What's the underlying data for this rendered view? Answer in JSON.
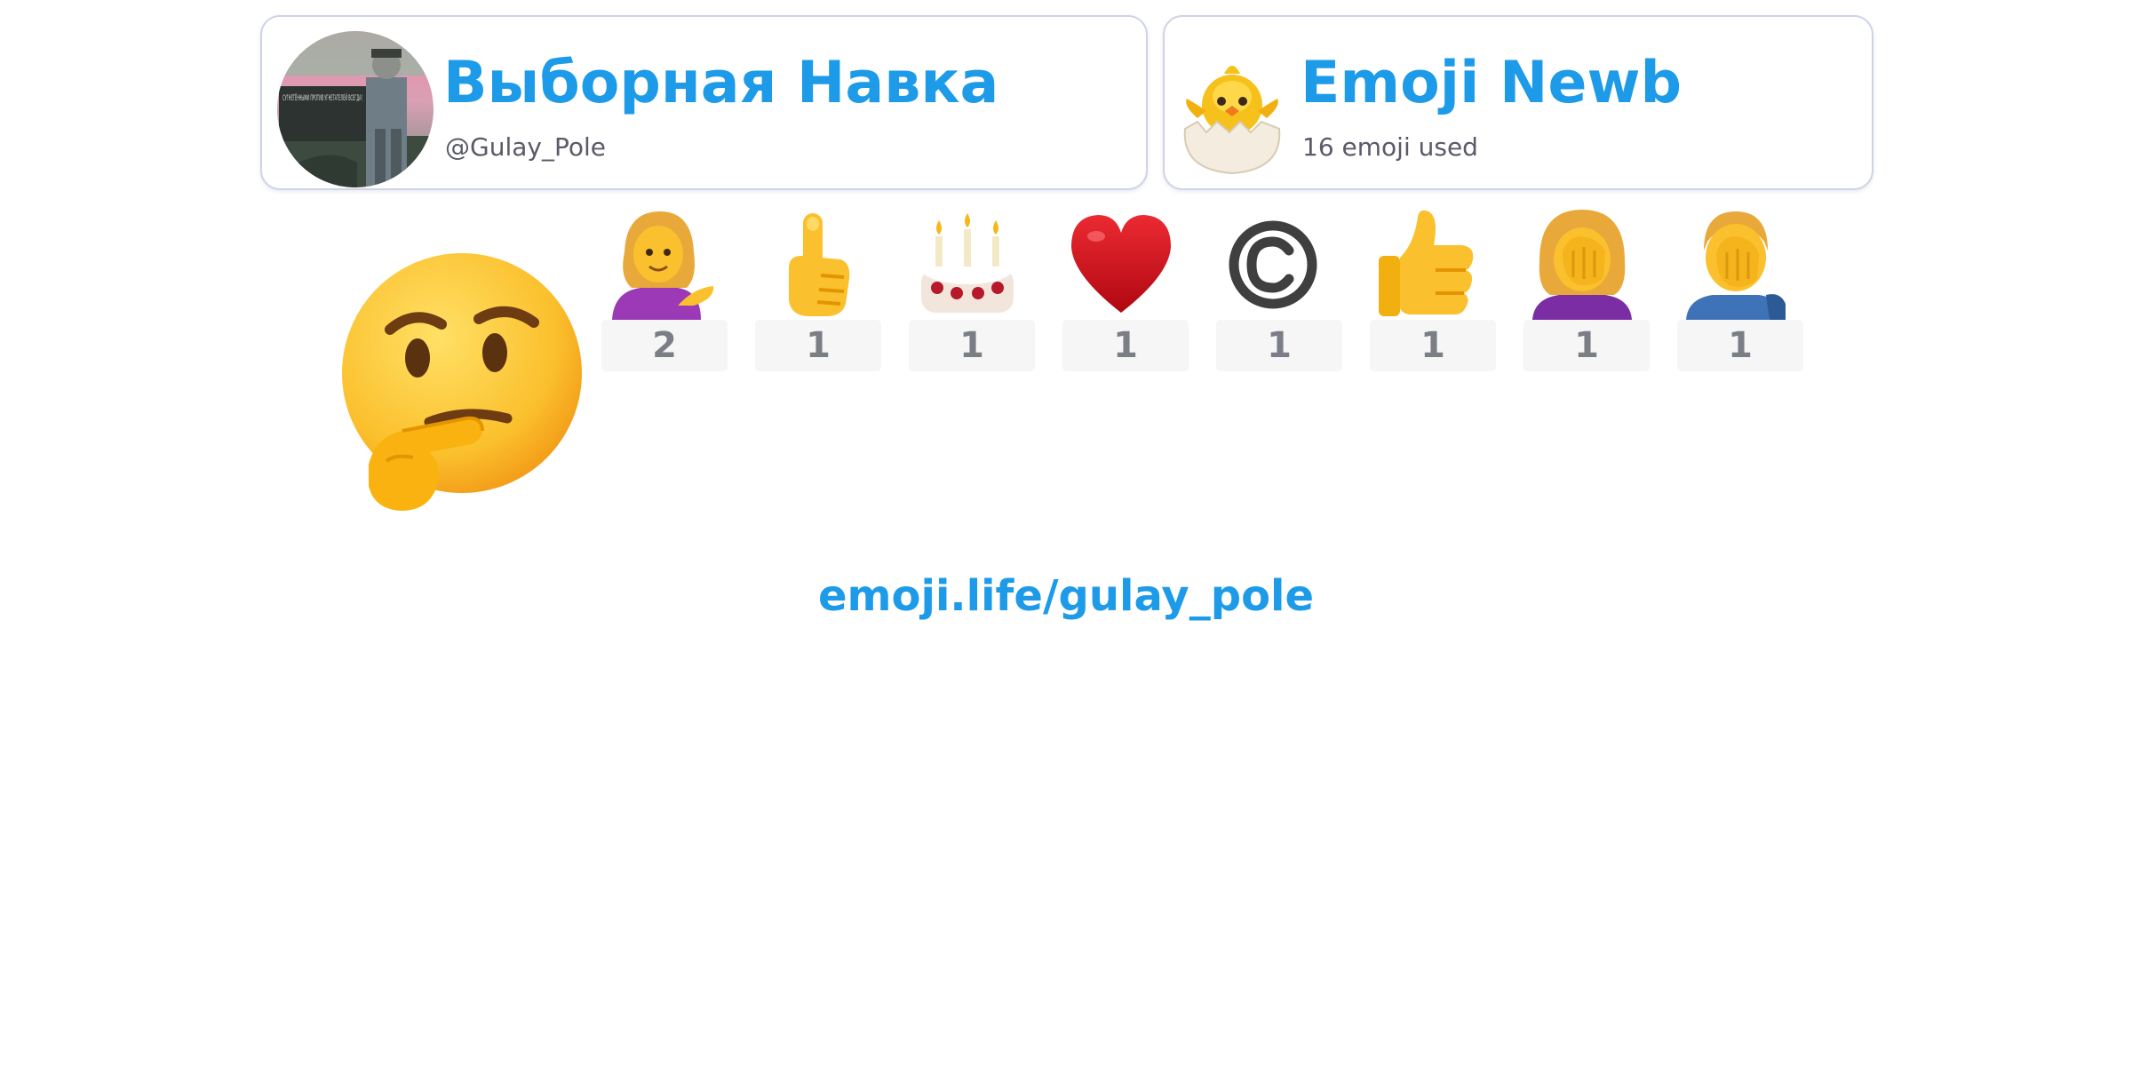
{
  "profile": {
    "display_name": "Выборная Навка",
    "handle": "@Gulay_Pole",
    "avatar_icon": "user-avatar-photo",
    "avatar_caption": "СУГНЕТЁННЫМИ ПРОТИВ УГНЕТАТЕЛЕЙ ВСЕГДА!"
  },
  "rank": {
    "title": "Emoji Newb",
    "subtitle": "16 emoji used",
    "icon": "hatching-chick-icon"
  },
  "featured_emoji": {
    "icon": "thinking-face-icon"
  },
  "emoji_counts": [
    {
      "icon": "woman-tipping-hand-icon",
      "count": "2"
    },
    {
      "icon": "pointing-up-icon",
      "count": "1"
    },
    {
      "icon": "birthday-cake-icon",
      "count": "1"
    },
    {
      "icon": "red-heart-icon",
      "count": "1"
    },
    {
      "icon": "copyright-icon",
      "count": "1"
    },
    {
      "icon": "thumbs-up-icon",
      "count": "1"
    },
    {
      "icon": "woman-facepalming-icon",
      "count": "1"
    },
    {
      "icon": "man-facepalming-icon",
      "count": "1"
    }
  ],
  "footer": {
    "link_text": "emoji.life/gulay_pole"
  },
  "colors": {
    "accent": "#1d9be8",
    "card_border": "#cfd3e6",
    "subtext": "#5a5a68",
    "count_background": "#f6f6f7",
    "count_text": "#7b7f85"
  }
}
